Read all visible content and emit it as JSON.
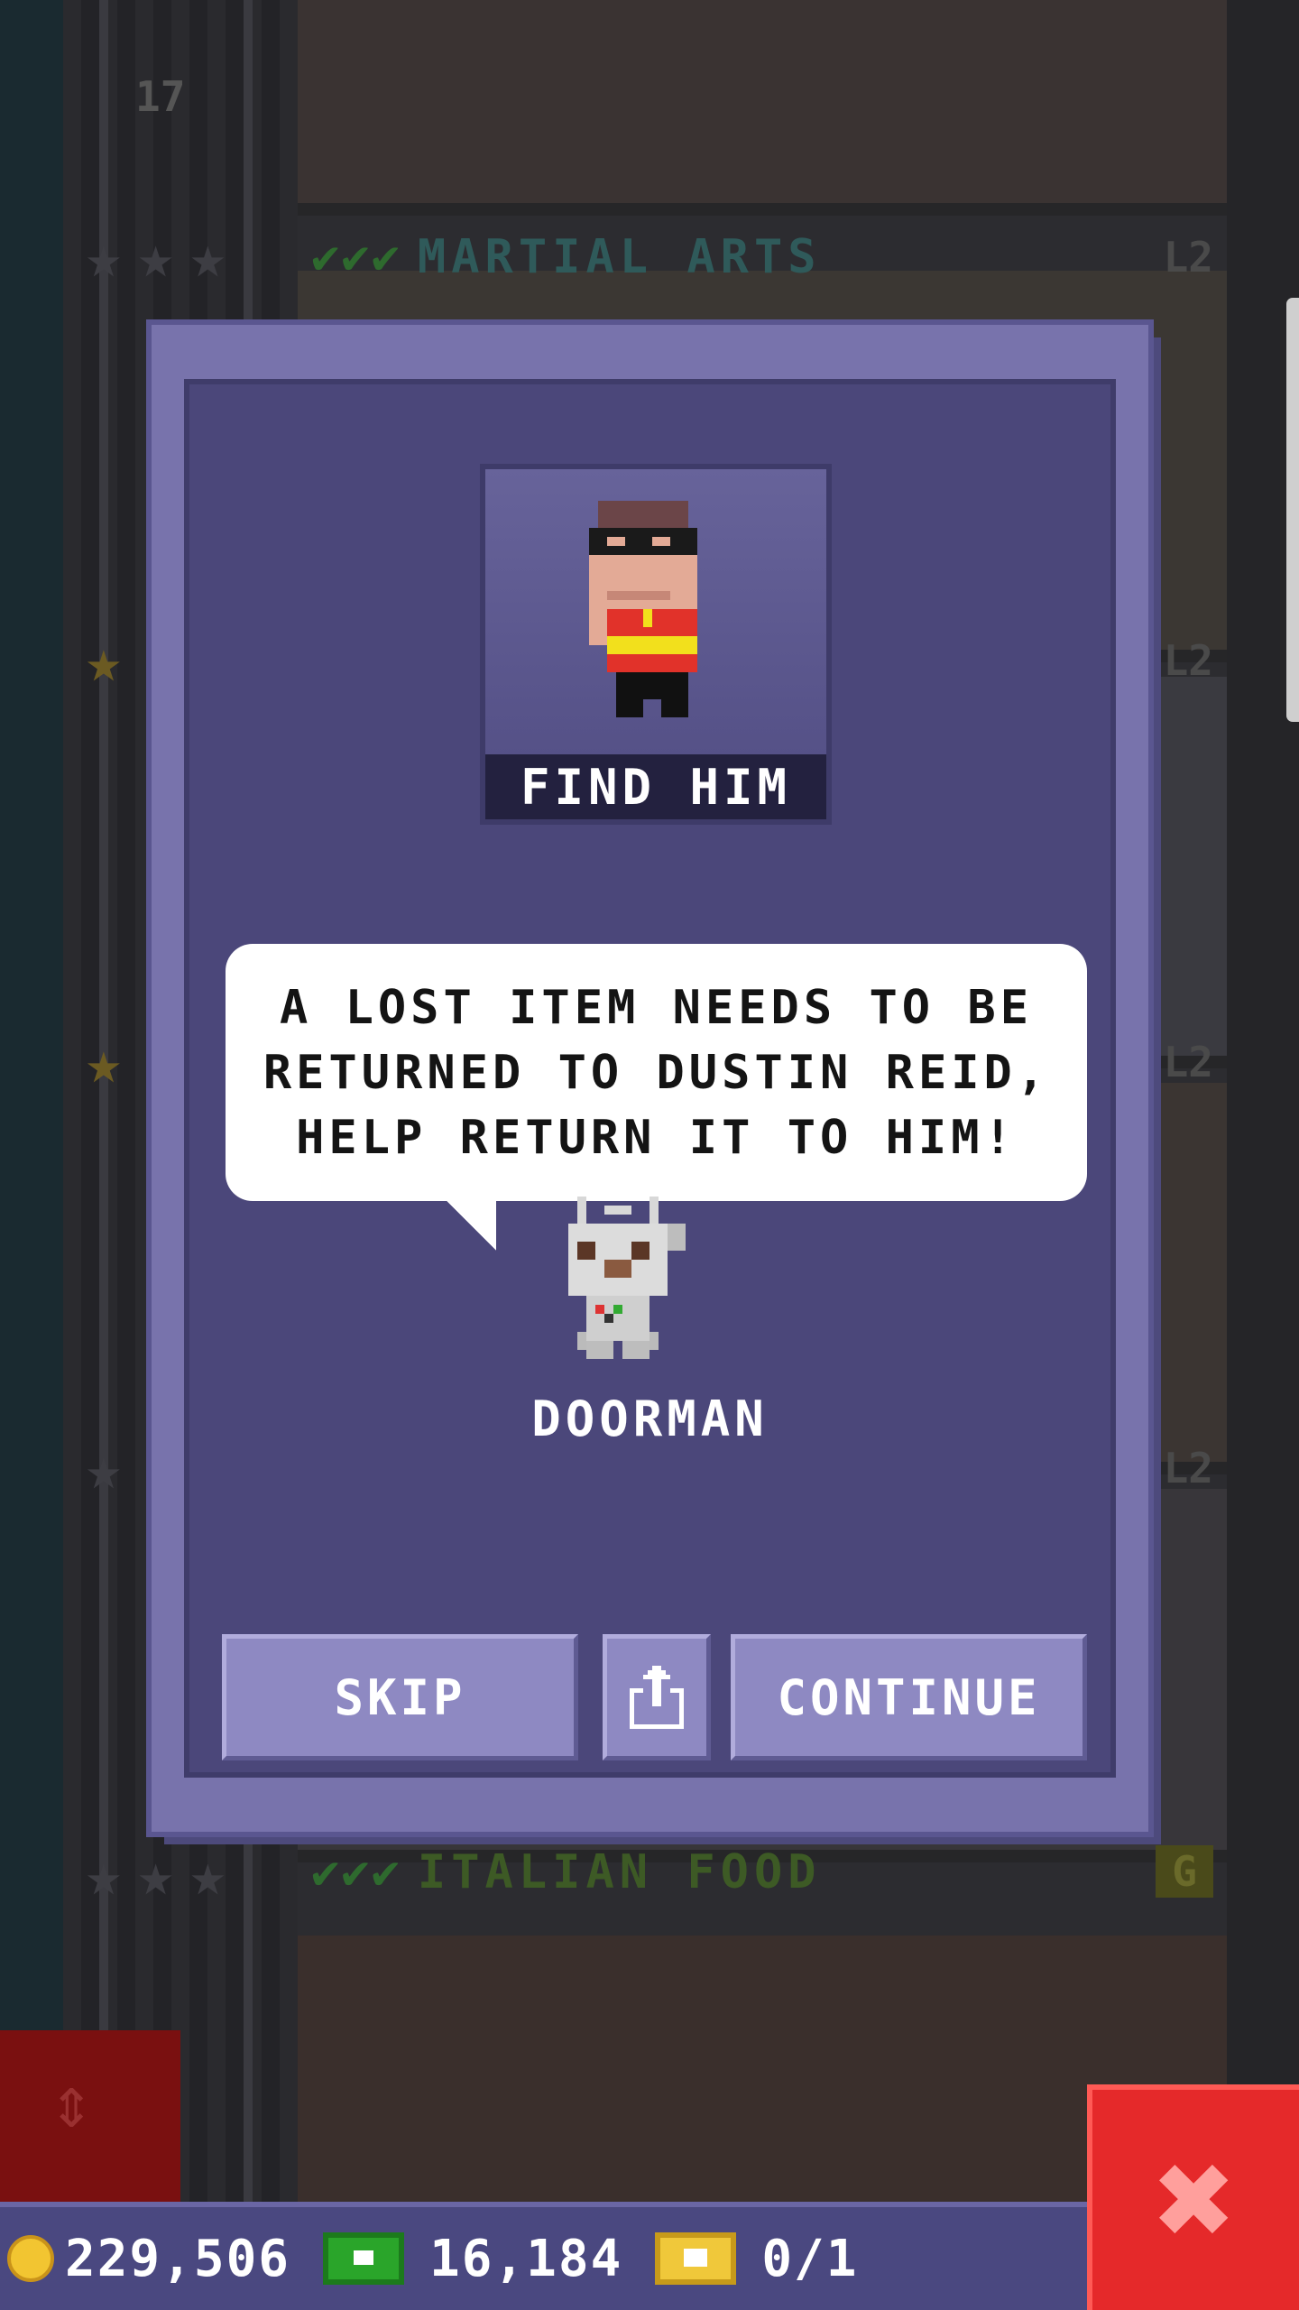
{
  "background": {
    "floor_number": "17",
    "rooms": [
      {
        "name": "MARTIAL ARTS",
        "level": "L2",
        "stars": 3
      },
      {
        "name": "ITALIAN FOOD",
        "level": "G",
        "stars": 3
      }
    ],
    "side_levels": [
      "L2",
      "L2",
      "L2"
    ]
  },
  "modal": {
    "portrait_label": "FIND HIM",
    "message": "A LOST ITEM NEEDS TO BE\nRETURNED TO DUSTIN REID,\nHELP RETURN IT TO HIM!",
    "npc_name": "DOORMAN",
    "buttons": {
      "skip": "SKIP",
      "share_icon": "share-icon",
      "continue": "CONTINUE"
    }
  },
  "status_bar": {
    "coins": "229,506",
    "bux": "16,184",
    "tickets": "0/1"
  },
  "colors": {
    "modal_frame": "#7873ac",
    "modal_inner": "#4b477a",
    "button": "#8e89c2",
    "close_red": "#e5292a"
  }
}
